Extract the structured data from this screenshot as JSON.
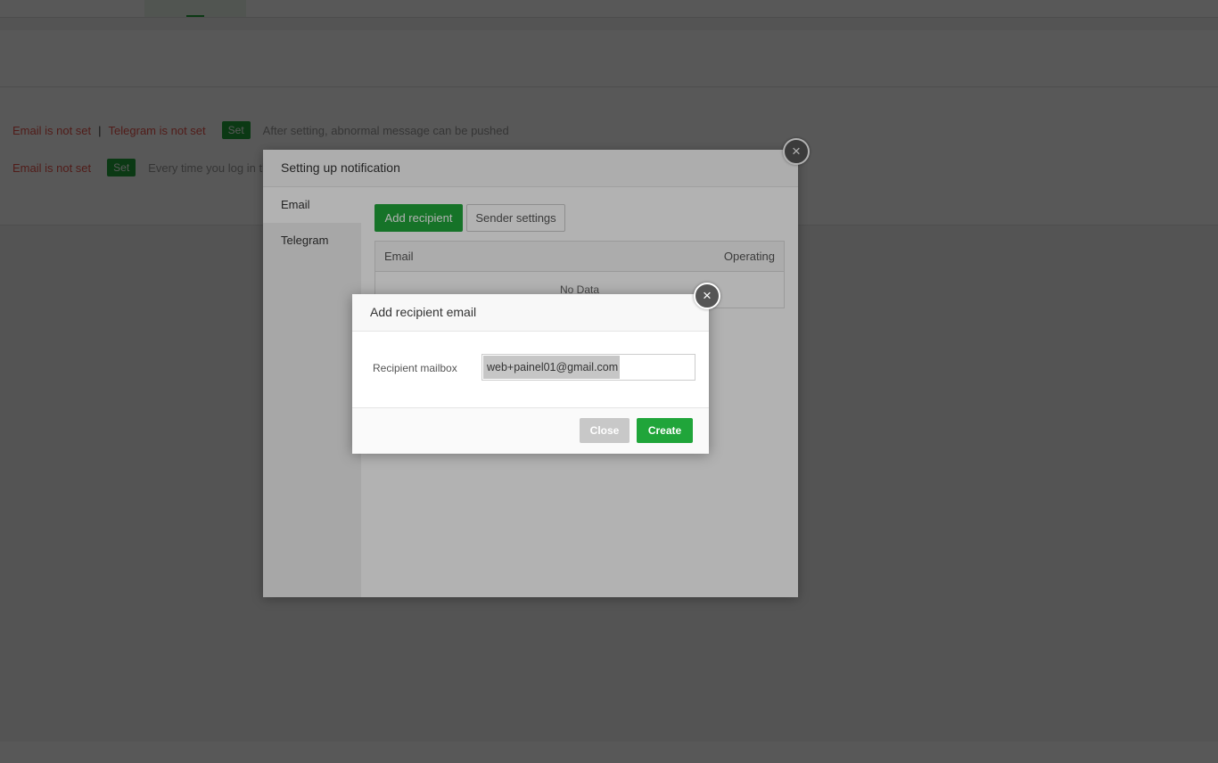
{
  "background": {
    "row1": {
      "email_status": "Email is not set",
      "separator": "|",
      "telegram_status": "Telegram is not set",
      "set_label": "Set",
      "hint": "After setting, abnormal message can be pushed"
    },
    "row2": {
      "email_status": "Email is not set",
      "set_label": "Set",
      "hint": "Every time you log in th"
    }
  },
  "notification_dialog": {
    "title": "Setting up notification",
    "tabs": [
      "Email",
      "Telegram"
    ],
    "add_recipient_label": "Add recipient",
    "sender_settings_label": "Sender settings",
    "table": {
      "columns": [
        "Email",
        "Operating"
      ],
      "empty_text": "No Data"
    },
    "close_icon": "×"
  },
  "recipient_dialog": {
    "title": "Add recipient email",
    "mailbox_label": "Recipient mailbox",
    "mailbox_value": "web+painel01@gmail.com",
    "close_label": "Close",
    "create_label": "Create",
    "close_icon": "×"
  },
  "colors": {
    "accent": "#20a53a",
    "warning": "#e8534b"
  }
}
